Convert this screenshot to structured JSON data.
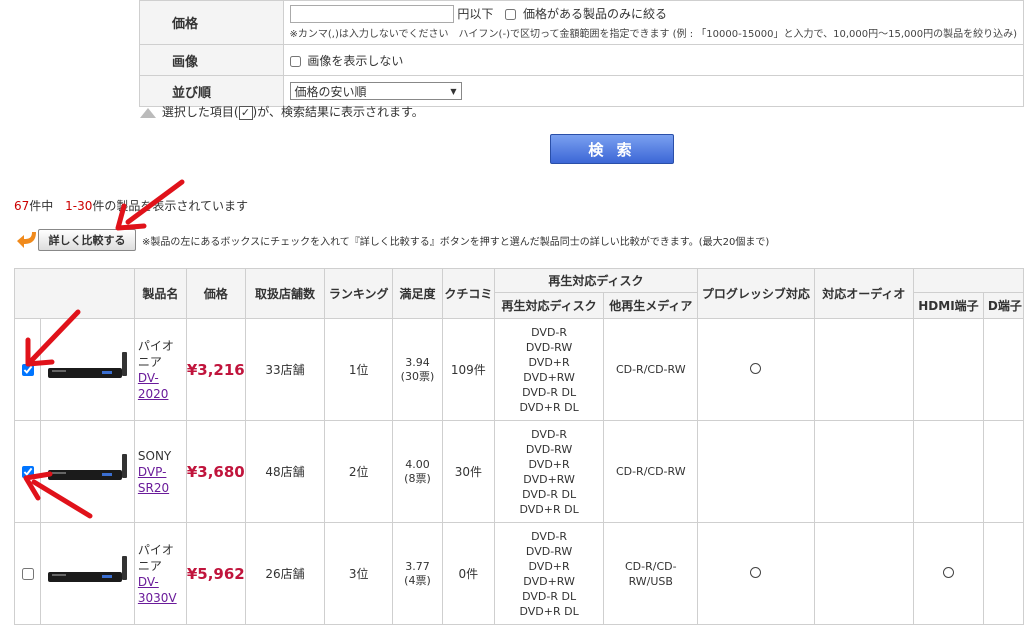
{
  "filter": {
    "price": {
      "label": "価格",
      "input_value": "",
      "suffix": "円以下",
      "only_price_label": "価格がある製品のみに絞る",
      "note": "※カンマ(,)は入力しないでください　ハイフン(-)で区切って金額範囲を指定できます (例 : 「10000-15000」と入力で、10,000円～15,000円の製品を絞り込み)"
    },
    "image": {
      "label": "画像",
      "hide_label": "画像を表示しない"
    },
    "sort": {
      "label": "並び順",
      "selected": "価格の安い順"
    }
  },
  "hint": {
    "before": "選択した項目(",
    "check": "✓",
    "after": ")が、検索結果に表示されます。"
  },
  "search_button": "検 索",
  "result_count": {
    "total": "67",
    "total_suffix": "件中",
    "range": "1-30",
    "range_suffix": "件の製品を表示されています"
  },
  "compare": {
    "button": "詳しく比較する",
    "note": "※製品の左にあるボックスにチェックを入れて『詳しく比較する』ボタンを押すと選んだ製品同士の詳しい比較ができます。(最大20個まで)"
  },
  "columns": {
    "name": "製品名",
    "price": "価格",
    "shops": "取扱店舗数",
    "ranking": "ランキング",
    "satisfaction": "満足度",
    "reviews": "クチコミ",
    "disc_group": "再生対応ディスク",
    "disc": "再生対応ディスク",
    "other_media": "他再生メディア",
    "progressive": "プログレッシブ対応",
    "audio": "対応オーディオ",
    "hdmi": "HDMI端子",
    "d_terminal": "D端子"
  },
  "products": [
    {
      "maker": "パイオニア",
      "model": "DV-2020",
      "price": "¥3,216",
      "shops": "33店舗",
      "ranking": "1位",
      "sat_score": "3.94",
      "sat_votes": "(30票)",
      "reviews": "109件",
      "discs": [
        "DVD-R",
        "DVD-RW",
        "DVD+R",
        "DVD+RW",
        "DVD-R DL",
        "DVD+R DL"
      ],
      "other_media": "CD-R/CD-RW",
      "progressive": "○",
      "hdmi": "",
      "checked": true
    },
    {
      "maker": "SONY",
      "model": "DVP-SR20",
      "price": "¥3,680",
      "shops": "48店舗",
      "ranking": "2位",
      "sat_score": "4.00",
      "sat_votes": "(8票)",
      "reviews": "30件",
      "discs": [
        "DVD-R",
        "DVD-RW",
        "DVD+R",
        "DVD+RW",
        "DVD-R DL",
        "DVD+R DL"
      ],
      "other_media": "CD-R/CD-RW",
      "progressive": "",
      "hdmi": "",
      "checked": true
    },
    {
      "maker": "パイオニア",
      "model": "DV-3030V",
      "price": "¥5,962",
      "shops": "26店舗",
      "ranking": "3位",
      "sat_score": "3.77",
      "sat_votes": "(4票)",
      "reviews": "0件",
      "discs": [
        "DVD-R",
        "DVD-RW",
        "DVD+R",
        "DVD+RW",
        "DVD-R DL",
        "DVD+R DL"
      ],
      "other_media": "CD-R/CD-RW/USB",
      "progressive": "○",
      "hdmi": "○",
      "checked": false
    }
  ]
}
